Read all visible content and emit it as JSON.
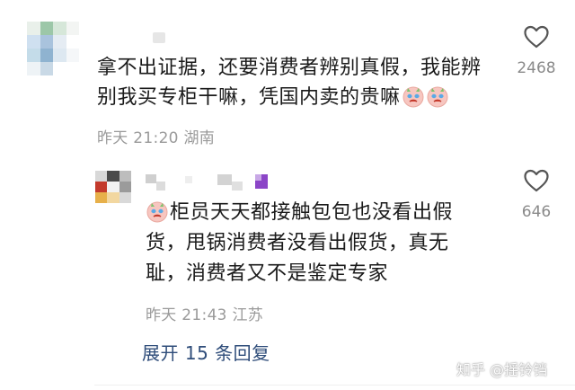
{
  "comment": {
    "lines": [
      "拿不出证据，还要消费者辨别真假，我能辨",
      "别我买专柜干嘛，凭国内卖的贵嘛"
    ],
    "meta": "昨天 21:20 湖南",
    "like_count": "2468",
    "avatar_colors": [
      "#e9f0ea",
      "#9cc7a8",
      "#d6e7d9",
      "#f3f5f3",
      "#cfe0f0",
      "#a9c3dd",
      "#e5ecf3",
      "#ffffff",
      "#c4dce9",
      "#8fb3d0",
      "#dde8f1",
      "#f5f7f9",
      "#eef3f6",
      "#c9d9e6",
      "#ffffff",
      "#ffffff"
    ]
  },
  "reply": {
    "lines": [
      "柜员天天都接触包包也没看出假",
      "货，甩锅消费者没看出假货，真无",
      "耻，消费者又不是鉴定专家"
    ],
    "meta": "昨天 21:43 江苏",
    "like_count": "646",
    "avatar_colors": [
      "#d8d8d8",
      "#4a4a4a",
      "#bdbdbd",
      "#c33a2c",
      "#f2f2f2",
      "#9b9b9b",
      "#e7b04a",
      "#f2d7a0",
      "#d9d9d9"
    ]
  },
  "more_replies": "展开 15 条回复",
  "watermark": "知乎 @摇铃铛",
  "icons": {
    "like": "heart-outline-icon",
    "emoji": "crying-face-icon"
  }
}
